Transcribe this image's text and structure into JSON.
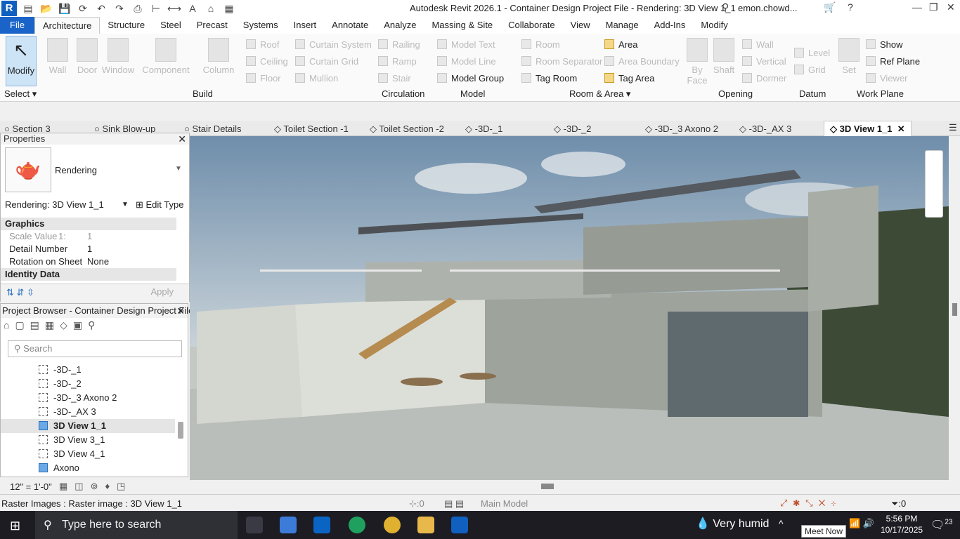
{
  "app": {
    "title": "Autodesk Revit 2026.1 - Container Design Project File - Rendering: 3D View 1_1",
    "user": "emon.chowd..."
  },
  "ribbon_tabs": [
    "File",
    "Architecture",
    "Structure",
    "Steel",
    "Precast",
    "Systems",
    "Insert",
    "Annotate",
    "Analyze",
    "Massing & Site",
    "Collaborate",
    "View",
    "Manage",
    "Add-Ins",
    "Modify"
  ],
  "ribbon": {
    "modify": "Modify",
    "select": "Select ▾",
    "big": [
      "Wall",
      "Door",
      "Window",
      "Component",
      "Column"
    ],
    "build_small": [
      "Roof",
      "Ceiling",
      "Floor",
      "Curtain System",
      "Curtain Grid",
      "Mullion"
    ],
    "circulation": [
      "Railing",
      "Ramp",
      "Stair"
    ],
    "model": [
      "Model Text",
      "Model Line",
      "Model Group"
    ],
    "room": [
      "Room",
      "Room Separator",
      "Tag Room",
      "Area",
      "Area Boundary",
      "Tag Area"
    ],
    "opening_big": [
      "By Face",
      "Shaft"
    ],
    "opening_small": [
      "Wall",
      "Vertical",
      "Dormer"
    ],
    "datum": [
      "Level",
      "Grid"
    ],
    "workplane_big": "Set",
    "workplane": [
      "Show",
      "Ref Plane",
      "Viewer"
    ],
    "panels": [
      "Build",
      "Circulation",
      "Model",
      "Room & Area ▾",
      "Opening",
      "Datum",
      "Work Plane"
    ]
  },
  "view_tabs": [
    "Section 3",
    "Sink Blow-up",
    "Stair Details",
    "Toilet Section -1",
    "Toilet Section -2",
    "-3D-_1",
    "-3D-_2",
    "-3D-_3 Axono 2",
    "-3D-_AX 3",
    "3D View 1_1"
  ],
  "properties": {
    "title": "Properties",
    "type_name": "Rendering",
    "instance": "Rendering: 3D View 1_1",
    "edit_type": "Edit Type",
    "sections": [
      "Graphics",
      "Identity Data"
    ],
    "rows": [
      {
        "k": "Scale Value",
        "unit": "1:",
        "v": "1"
      },
      {
        "k": "Detail Number",
        "unit": "",
        "v": "1"
      },
      {
        "k": "Rotation on Sheet",
        "unit": "",
        "v": "None"
      }
    ],
    "apply": "Apply"
  },
  "project_browser": {
    "title": "Project Browser - Container Design Project File",
    "search_placeholder": "Search",
    "items": [
      "-3D-_1",
      "-3D-_2",
      "-3D-_3 Axono 2",
      "-3D-_AX 3",
      "3D View 1_1",
      "3D View 3_1",
      "3D View 4_1",
      "Axono"
    ],
    "selected": "3D View 1_1"
  },
  "view_control": {
    "scale": "12\" = 1'-0\""
  },
  "status": {
    "message": "Raster Images : Raster image : 3D View 1_1",
    "sel_count": ":0",
    "model": "Main Model",
    "filter_count": ":0"
  },
  "taskbar": {
    "search": "Type here to search",
    "weather": "Very humid",
    "time": "5:56 PM",
    "date": "10/17/2025",
    "notifications": "23",
    "tooltip": "Meet Now"
  }
}
